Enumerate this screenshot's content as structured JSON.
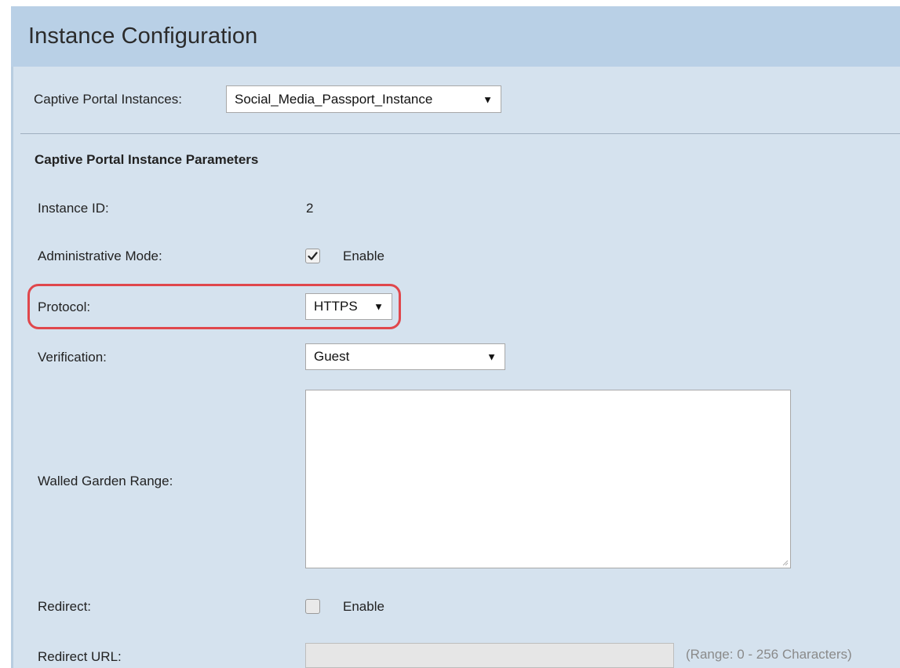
{
  "header": {
    "title": "Instance Configuration"
  },
  "instances": {
    "label": "Captive Portal Instances:",
    "selected": "Social_Media_Passport_Instance"
  },
  "section": {
    "heading": "Captive Portal Instance Parameters"
  },
  "fields": {
    "instance_id": {
      "label": "Instance ID:",
      "value": "2"
    },
    "admin_mode": {
      "label": "Administrative Mode:",
      "checkbox_label": "Enable",
      "checked": true
    },
    "protocol": {
      "label": "Protocol:",
      "selected": "HTTPS"
    },
    "verification": {
      "label": "Verification:",
      "selected": "Guest"
    },
    "walled_garden": {
      "label": "Walled Garden Range:",
      "value": ""
    },
    "redirect": {
      "label": "Redirect:",
      "checkbox_label": "Enable",
      "checked": false
    },
    "redirect_url": {
      "label": "Redirect URL:",
      "value": "",
      "hint": "(Range: 0 - 256 Characters)"
    }
  },
  "icons": {
    "dropdown": "chevron-down-icon",
    "check": "checkmark-icon",
    "resize": "resize-grip-icon"
  },
  "colors": {
    "header_bg": "#b9d0e6",
    "panel_bg": "#d5e2ee",
    "highlight": "#e0474c",
    "hint_text": "#8a8a8a"
  }
}
